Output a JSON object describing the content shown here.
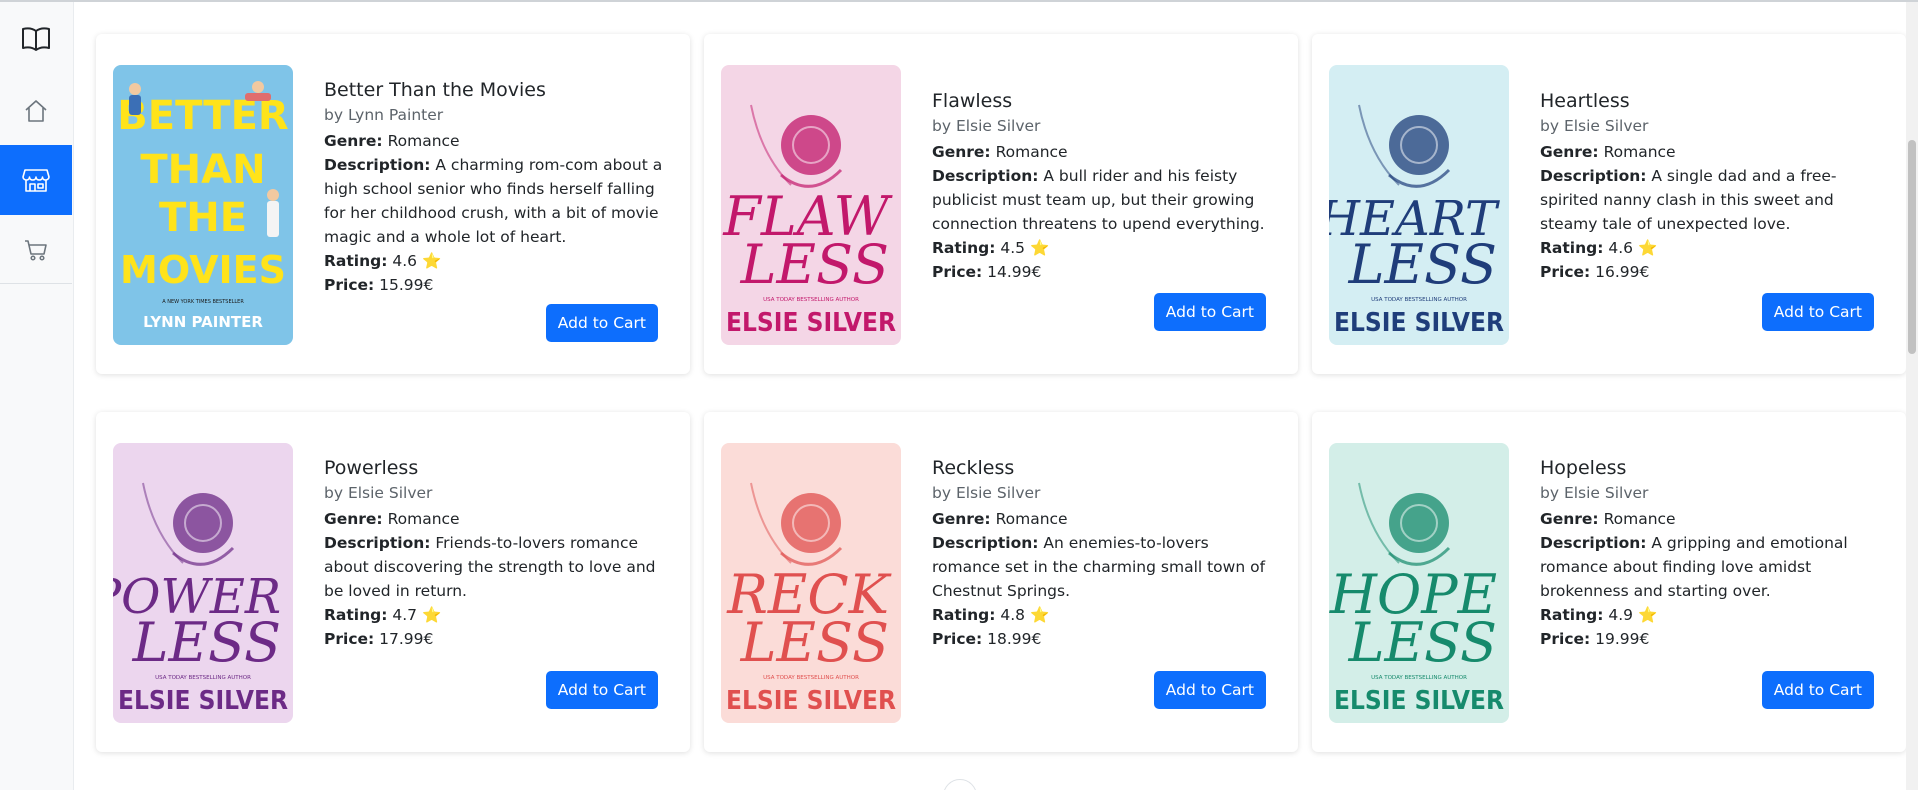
{
  "sidebar": {
    "brand_icon": "open-book-icon",
    "items": [
      {
        "name": "home",
        "icon": "house-icon",
        "active": false
      },
      {
        "name": "shop",
        "icon": "storefront-icon",
        "active": true
      },
      {
        "name": "cart",
        "icon": "cart-icon",
        "active": false
      }
    ]
  },
  "labels": {
    "genre": "Genre:",
    "description": "Description:",
    "rating": "Rating:",
    "price": "Price:",
    "add_to_cart": "Add to Cart"
  },
  "books": [
    {
      "title": "Better Than the Movies",
      "author": "by Lynn Painter",
      "genre": "Romance",
      "description": "A charming rom-com about a high school senior who finds herself falling for her childhood crush, with a bit of movie magic and a whole lot of heart.",
      "rating": "4.6 ⭐",
      "price": "15.99€",
      "cover": {
        "bg": "#7fc4e8",
        "text": "#ffe31a",
        "line1": "BETTER THAN THE MOVIES",
        "line2": "LYNN PAINTER",
        "tagline": "A NEW YORK TIMES BESTSELLER"
      }
    },
    {
      "title": "Flawless",
      "author": "by Elsie Silver",
      "genre": "Romance",
      "description": "A bull rider and his feisty publicist must team up, but their growing connection threatens to upend everything.",
      "rating": "4.5 ⭐",
      "price": "14.99€",
      "cover": {
        "bg": "#f4d6e6",
        "text": "#c2186b",
        "line1": "FLAW",
        "line1b": "LESS",
        "line2": "ELSIE SILVER",
        "tagline": "USA TODAY BESTSELLING AUTHOR"
      }
    },
    {
      "title": "Heartless",
      "author": "by Elsie Silver",
      "genre": "Romance",
      "description": "A single dad and a free-spirited nanny clash in this sweet and steamy tale of unexpected love.",
      "rating": "4.6 ⭐",
      "price": "16.99€",
      "cover": {
        "bg": "#d4eef3",
        "text": "#1f3d7a",
        "line1": "HEART",
        "line1b": "LESS",
        "line2": "ELSIE SILVER",
        "tagline": "USA TODAY BESTSELLING AUTHOR"
      }
    },
    {
      "title": "Powerless",
      "author": "by Elsie Silver",
      "genre": "Romance",
      "description": "Friends-to-lovers romance about discovering the strength to love and be loved in return.",
      "rating": "4.7 ⭐",
      "price": "17.99€",
      "cover": {
        "bg": "#ecd6ee",
        "text": "#6c2a86",
        "line1": "POWER",
        "line1b": "LESS",
        "line2": "ELSIE SILVER",
        "tagline": "USA TODAY BESTSELLING AUTHOR"
      }
    },
    {
      "title": "Reckless",
      "author": "by Elsie Silver",
      "genre": "Romance",
      "description": "An enemies-to-lovers romance set in the charming small town of Chestnut Springs.",
      "rating": "4.8 ⭐",
      "price": "18.99€",
      "cover": {
        "bg": "#fbdcd8",
        "text": "#e0504f",
        "line1": "RECK",
        "line1b": "LESS",
        "line2": "ELSIE SILVER",
        "tagline": "USA TODAY BESTSELLING AUTHOR"
      }
    },
    {
      "title": "Hopeless",
      "author": "by Elsie Silver",
      "genre": "Romance",
      "description": "A gripping and emotional romance about finding love amidst brokenness and starting over.",
      "rating": "4.9 ⭐",
      "price": "19.99€",
      "cover": {
        "bg": "#d3eee8",
        "text": "#168a6c",
        "line1": "HOPE",
        "line1b": "LESS",
        "line2": "ELSIE SILVER",
        "tagline": "USA TODAY BESTSELLING AUTHOR"
      }
    }
  ]
}
